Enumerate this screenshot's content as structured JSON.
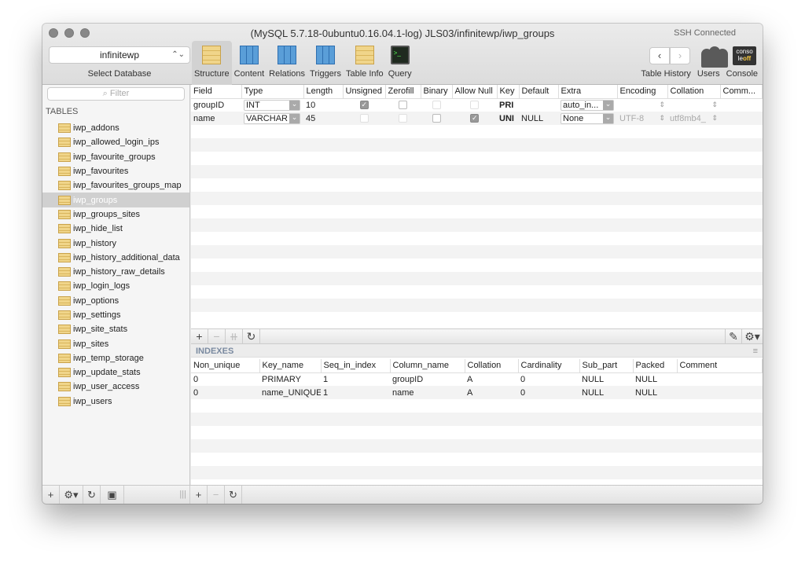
{
  "window": {
    "title": "(MySQL 5.7.18-0ubuntu0.16.04.1-log) JLS03/infinitewp/iwp_groups",
    "status": "SSH Connected"
  },
  "database_selector": {
    "value": "infinitewp",
    "label": "Select Database"
  },
  "toolbar": {
    "tabs": [
      {
        "label": "Structure",
        "icon": "structure-icon",
        "active": true
      },
      {
        "label": "Content",
        "icon": "content-icon",
        "active": false
      },
      {
        "label": "Relations",
        "icon": "relations-icon",
        "active": false
      },
      {
        "label": "Triggers",
        "icon": "triggers-icon",
        "active": false
      },
      {
        "label": "Table Info",
        "icon": "table-info-icon",
        "active": false
      },
      {
        "label": "Query",
        "icon": "query-icon",
        "active": false
      }
    ],
    "table_history_label": "Table History",
    "users_label": "Users",
    "console_label": "Console",
    "console_icon_text_1": "conso",
    "console_icon_text_2": "le",
    "console_icon_text_3": "off"
  },
  "sidebar": {
    "filter_placeholder": "Filter",
    "section_title": "TABLES",
    "tables": [
      "iwp_addons",
      "iwp_allowed_login_ips",
      "iwp_favourite_groups",
      "iwp_favourites",
      "iwp_favourites_groups_map",
      "iwp_groups",
      "iwp_groups_sites",
      "iwp_hide_list",
      "iwp_history",
      "iwp_history_additional_data",
      "iwp_history_raw_details",
      "iwp_login_logs",
      "iwp_options",
      "iwp_settings",
      "iwp_site_stats",
      "iwp_sites",
      "iwp_temp_storage",
      "iwp_update_stats",
      "iwp_user_access",
      "iwp_users"
    ],
    "selected": "iwp_groups"
  },
  "structure": {
    "columns": [
      "Field",
      "Type",
      "Length",
      "Unsigned",
      "Zerofill",
      "Binary",
      "Allow Null",
      "Key",
      "Default",
      "Extra",
      "Encoding",
      "Collation",
      "Comm..."
    ],
    "rows": [
      {
        "field": "groupID",
        "type": "INT",
        "length": "10",
        "unsigned": true,
        "zerofill": false,
        "binary": false,
        "allow_null": false,
        "key": "PRI",
        "default": "",
        "extra": "auto_in...",
        "encoding": "",
        "collation": ""
      },
      {
        "field": "name",
        "type": "VARCHAR",
        "length": "45",
        "unsigned": false,
        "zerofill": false,
        "binary": false,
        "allow_null": true,
        "key": "UNI",
        "default": "NULL",
        "extra": "None",
        "encoding": "UTF-8",
        "collation": "utf8mb4_"
      }
    ]
  },
  "indexes": {
    "title": "INDEXES",
    "columns": [
      "Non_unique",
      "Key_name",
      "Seq_in_index",
      "Column_name",
      "Collation",
      "Cardinality",
      "Sub_part",
      "Packed",
      "Comment"
    ],
    "rows": [
      [
        "0",
        "PRIMARY",
        "1",
        "groupID",
        "A",
        "0",
        "NULL",
        "NULL",
        ""
      ],
      [
        "0",
        "name_UNIQUE",
        "1",
        "name",
        "A",
        "0",
        "NULL",
        "NULL",
        ""
      ]
    ]
  }
}
